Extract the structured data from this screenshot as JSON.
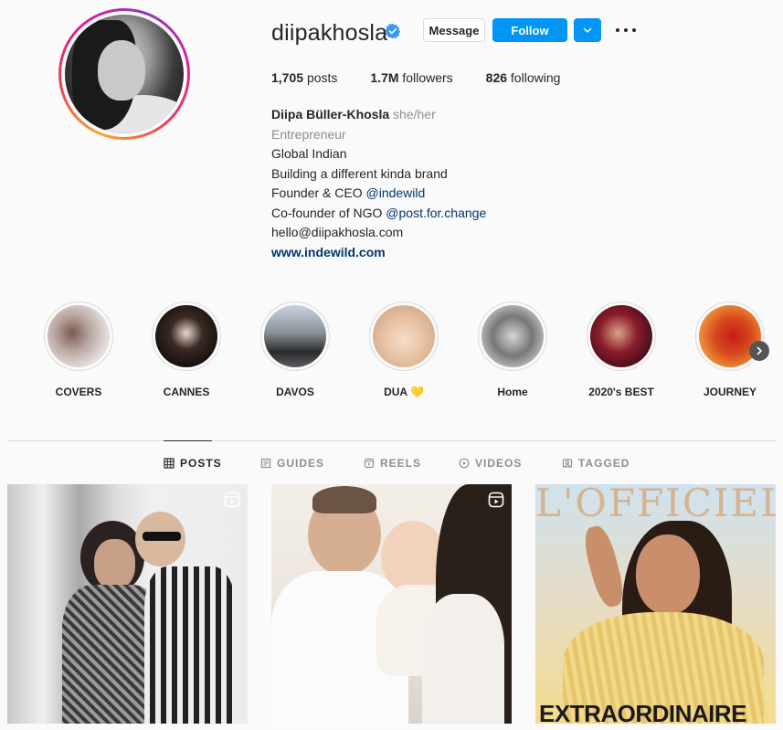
{
  "profile": {
    "username": "diipakhosla",
    "verified_icon": "verified-badge-icon",
    "buttons": {
      "message": "Message",
      "follow": "Follow",
      "dropdown": "⌄",
      "more": "more-options-icon"
    },
    "stats": [
      {
        "value": "1,705",
        "label": "posts"
      },
      {
        "value": "1.7M",
        "label": "followers"
      },
      {
        "value": "826",
        "label": "following"
      }
    ],
    "bio": {
      "name": "Diipa Büller-Khosla",
      "pronouns": "she/her",
      "category": "Entrepreneur",
      "line1": "Global Indian",
      "line2": "Building a different kinda brand",
      "line3_prefix": "Founder & CEO ",
      "line3_link": "@indewild",
      "line4_prefix": "Co-founder of NGO ",
      "line4_link": "@post.for.change",
      "line5": "hello@diipakhosla.com",
      "website": "www.indewild.com"
    }
  },
  "highlights": [
    {
      "label": "COVERS"
    },
    {
      "label": "CANNES"
    },
    {
      "label": "DAVOS"
    },
    {
      "label": "DUA 💛"
    },
    {
      "label": "Home"
    },
    {
      "label": "2020's BEST"
    },
    {
      "label": "JOURNEY"
    }
  ],
  "tabs": [
    {
      "label": "POSTS",
      "icon": "grid-icon",
      "active": true
    },
    {
      "label": "GUIDES",
      "icon": "guides-icon",
      "active": false
    },
    {
      "label": "REELS",
      "icon": "reels-icon",
      "active": false
    },
    {
      "label": "VIDEOS",
      "icon": "video-icon",
      "active": false
    },
    {
      "label": "TAGGED",
      "icon": "tagged-icon",
      "active": false
    }
  ],
  "posts": [
    {
      "type": "reel"
    },
    {
      "type": "reel"
    },
    {
      "type": "image",
      "cover_text": "EXTRAORDINAIRE",
      "masthead": "L'OFFICIEL"
    }
  ],
  "colors": {
    "accent": "#0095f6",
    "link": "#00376b",
    "muted": "#8e8e8e",
    "text": "#262626"
  }
}
